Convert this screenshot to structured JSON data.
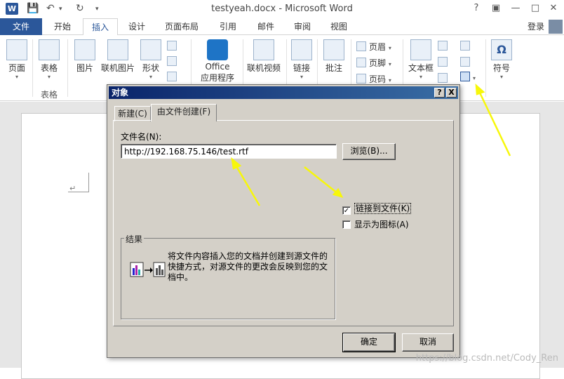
{
  "window": {
    "logo": "W",
    "title": "testyeah.docx - Microsoft Word",
    "help": "?",
    "restore": "▣",
    "minimize": "—",
    "close": "✕"
  },
  "tabs": {
    "file": "文件",
    "items": [
      "开始",
      "插入",
      "设计",
      "页面布局",
      "引用",
      "邮件",
      "审阅",
      "视图"
    ],
    "active": "插入",
    "login": "登录"
  },
  "ribbon": {
    "page": "页面",
    "table": "表格",
    "table_group": "表格",
    "picture": "图片",
    "online_picture": "联机图片",
    "shapes": "形状",
    "office_apps_line1": "Office",
    "office_apps_line2": "应用程序",
    "online_video": "联机视频",
    "link": "链接",
    "comment": "批注",
    "header": "页眉",
    "footer": "页脚",
    "page_number": "页码",
    "textbox": "文本框",
    "symbol": "符号"
  },
  "dialog": {
    "title": "对象",
    "help_btn": "?",
    "close_btn": "X",
    "tab_new": "新建(C)",
    "tab_from_file": "由文件创建(F)",
    "filename_label": "文件名(N):",
    "filename_value": "http://192.168.75.146/test.rtf",
    "browse": "浏览(B)...",
    "link_to_file": "链接到文件(K)",
    "link_checked": true,
    "display_as_icon": "显示为图标(A)",
    "icon_checked": false,
    "result_title": "结果",
    "result_text": "将文件内容插入您的文档并创建到源文件的快捷方式，对源文件的更改会反映到您的文档中。",
    "ok": "确定",
    "cancel": "取消"
  },
  "watermark": "https://blog.csdn.net/Cody_Ren",
  "colors": {
    "accent": "#2b579a",
    "arrow": "#f7f70a"
  }
}
